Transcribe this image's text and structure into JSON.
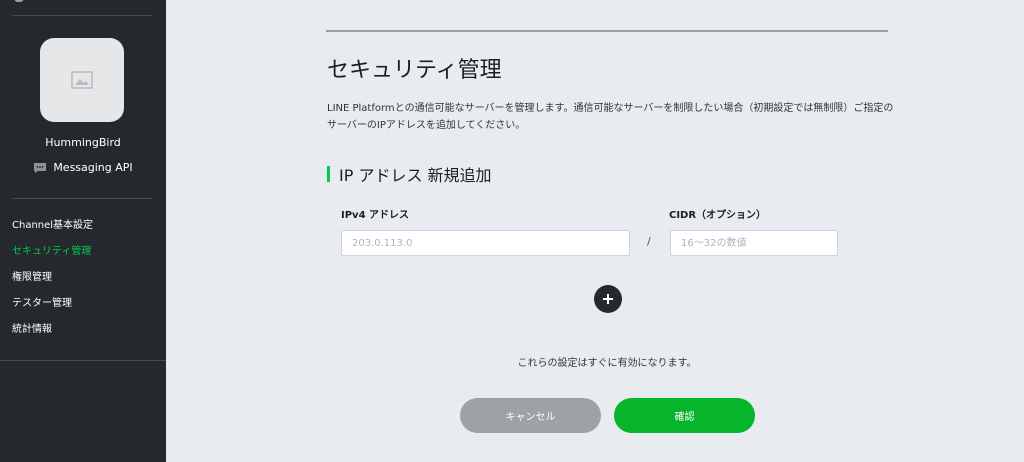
{
  "sidebar": {
    "channel": {
      "name": "HummingBird",
      "type_label": "Messaging API",
      "avatar_icon": "image-placeholder-icon"
    },
    "nav_items": [
      {
        "label": "Channel基本設定",
        "active": false
      },
      {
        "label": "セキュリティ管理",
        "active": true
      },
      {
        "label": "権限管理",
        "active": false
      },
      {
        "label": "テスター管理",
        "active": false
      },
      {
        "label": "統計情報",
        "active": false
      }
    ]
  },
  "main": {
    "title": "セキュリティ管理",
    "description": "LINE Platformとの通信可能なサーバーを管理します。通信可能なサーバーを制限したい場合（初期設定では無制限）ご指定のサーバーのIPアドレスを追加してください。",
    "section_heading": "IP アドレス 新規追加",
    "ip_field": {
      "label": "IPv4 アドレス",
      "placeholder": "203.0.113.0",
      "value": ""
    },
    "separator": "/",
    "cidr_field": {
      "label": "CIDR（オプション）",
      "placeholder": "16〜32の数値",
      "value": ""
    },
    "add_icon": "plus-icon",
    "notice": "これらの設定はすぐに有効になります。",
    "cancel_label": "キャンセル",
    "confirm_label": "確認"
  },
  "colors": {
    "sidebar_bg": "#25292e",
    "page_bg": "#e8ecf0",
    "accent_green": "#06c755",
    "confirm_green": "#06b52c",
    "cancel_gray": "#9ea2a7"
  }
}
